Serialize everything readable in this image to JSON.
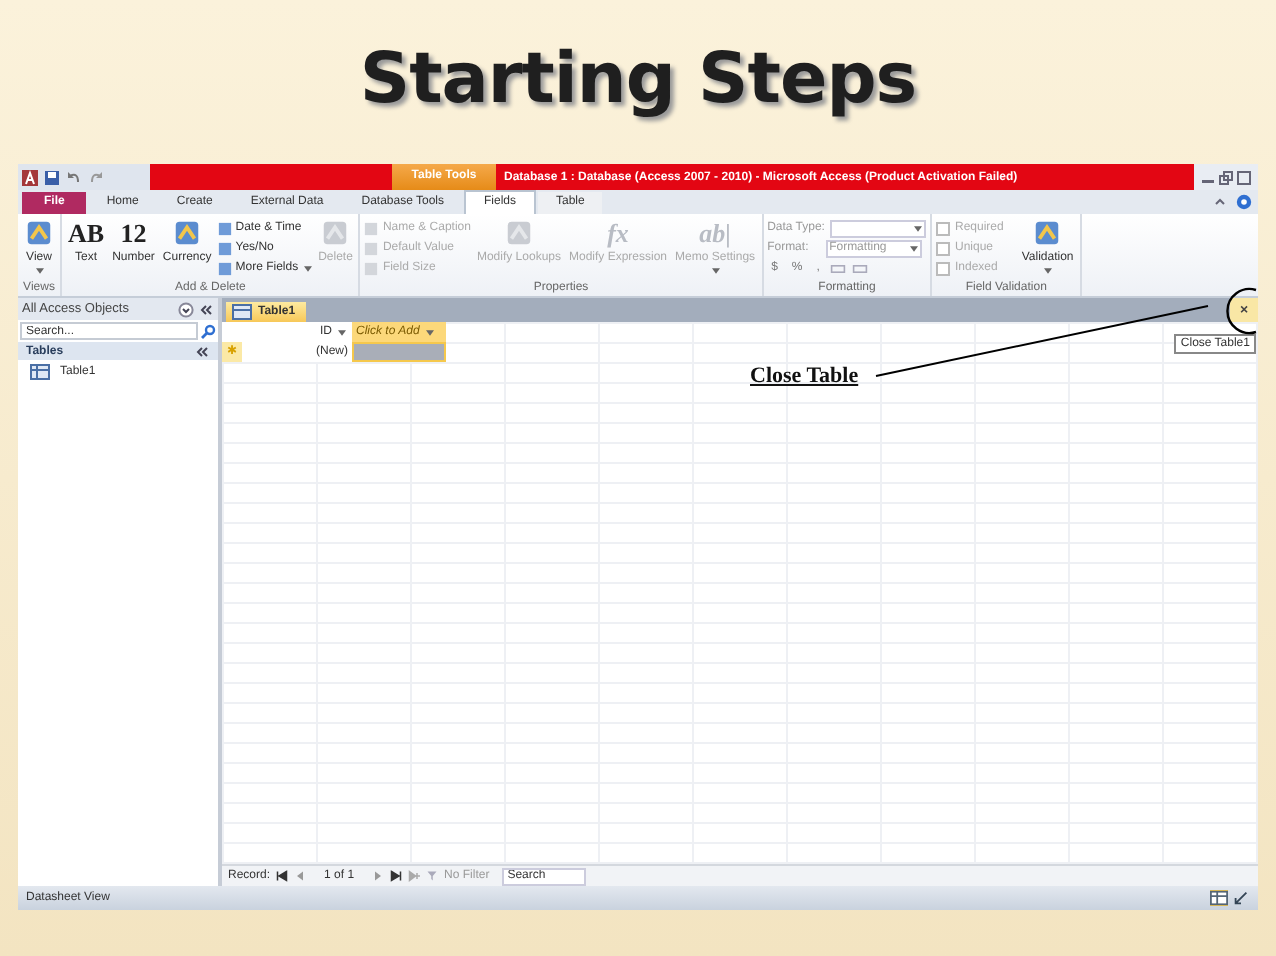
{
  "slide_title": "Starting Steps",
  "window": {
    "title": "Database 1 : Database (Access 2007 - 2010) - Microsoft Access (Product Activation Failed)",
    "context_group": "Table Tools"
  },
  "ribbon_tabs": [
    {
      "label": "File",
      "kind": "file",
      "selected": false
    },
    {
      "label": "Home",
      "kind": "tab",
      "selected": false
    },
    {
      "label": "Create",
      "kind": "tab",
      "selected": false
    },
    {
      "label": "External Data",
      "kind": "tab",
      "selected": false
    },
    {
      "label": "Database Tools",
      "kind": "tab",
      "selected": false
    },
    {
      "label": "Fields",
      "kind": "context",
      "selected": true
    },
    {
      "label": "Table",
      "kind": "context",
      "selected": false
    }
  ],
  "ribbon_groups": [
    {
      "label": "Views",
      "commands": [
        {
          "kind": "large",
          "label": "View",
          "disabled": false,
          "dropdown": true
        }
      ]
    },
    {
      "label": "Add & Delete",
      "commands": [
        {
          "kind": "large",
          "label": "Text",
          "glyph": "AB",
          "disabled": false
        },
        {
          "kind": "large",
          "label": "Number",
          "glyph": "12",
          "disabled": false
        },
        {
          "kind": "large",
          "label": "Currency",
          "disabled": false
        },
        {
          "kind": "small",
          "label": "Date & Time",
          "disabled": false
        },
        {
          "kind": "small",
          "label": "Yes/No",
          "disabled": false
        },
        {
          "kind": "small",
          "label": "More Fields",
          "disabled": false,
          "dropdown": true
        },
        {
          "kind": "large",
          "label": "Delete",
          "disabled": true
        }
      ]
    },
    {
      "label": "Properties",
      "commands": [
        {
          "kind": "small",
          "label": "Name & Caption",
          "disabled": true
        },
        {
          "kind": "small",
          "label": "Default Value",
          "disabled": true
        },
        {
          "kind": "small",
          "label": "Field Size",
          "disabled": true
        },
        {
          "kind": "large",
          "label": "Modify Lookups",
          "disabled": true
        },
        {
          "kind": "large",
          "label": "Modify Expression",
          "glyph": "fx",
          "disabled": true
        },
        {
          "kind": "large",
          "label": "Memo Settings",
          "glyph": "ab|",
          "disabled": true,
          "dropdown": true
        }
      ]
    },
    {
      "label": "Formatting",
      "commands": [
        {
          "kind": "field",
          "label": "Data Type:",
          "disabled": true
        },
        {
          "kind": "field",
          "label": "Format:",
          "value": "Formatting",
          "disabled": true
        },
        {
          "kind": "symbols",
          "symbols": [
            "$",
            "%",
            ","
          ],
          "disabled": true
        }
      ]
    },
    {
      "label": "Field Validation",
      "commands": [
        {
          "kind": "check",
          "label": "Required",
          "checked": false,
          "disabled": true
        },
        {
          "kind": "check",
          "label": "Unique",
          "checked": false,
          "disabled": true
        },
        {
          "kind": "check",
          "label": "Indexed",
          "checked": false,
          "disabled": true
        },
        {
          "kind": "large",
          "label": "Validation",
          "disabled": false,
          "dropdown": true
        }
      ]
    }
  ],
  "navigation_pane": {
    "header": "All Access Objects",
    "search": {
      "placeholder": "Search..."
    },
    "section": "Tables",
    "items": [
      {
        "label": "Table1",
        "selected": false
      }
    ]
  },
  "document_tabs": [
    {
      "label": "Table1",
      "selected": true
    }
  ],
  "close_button": {
    "label": "×",
    "tooltip": "Close Table1"
  },
  "datasheet": {
    "columns": [
      {
        "label": "ID",
        "kind": "field"
      },
      {
        "label": "Click to Add",
        "kind": "add"
      }
    ],
    "new_row": {
      "marker": "✱",
      "cells": [
        "(New)",
        ""
      ]
    }
  },
  "record_navigator": {
    "label": "Record:",
    "position": "1 of 1",
    "filter": "No Filter",
    "search": {
      "placeholder": "Search"
    }
  },
  "status_bar": {
    "text": "Datasheet View"
  },
  "annotation": {
    "text": "Close Table"
  }
}
